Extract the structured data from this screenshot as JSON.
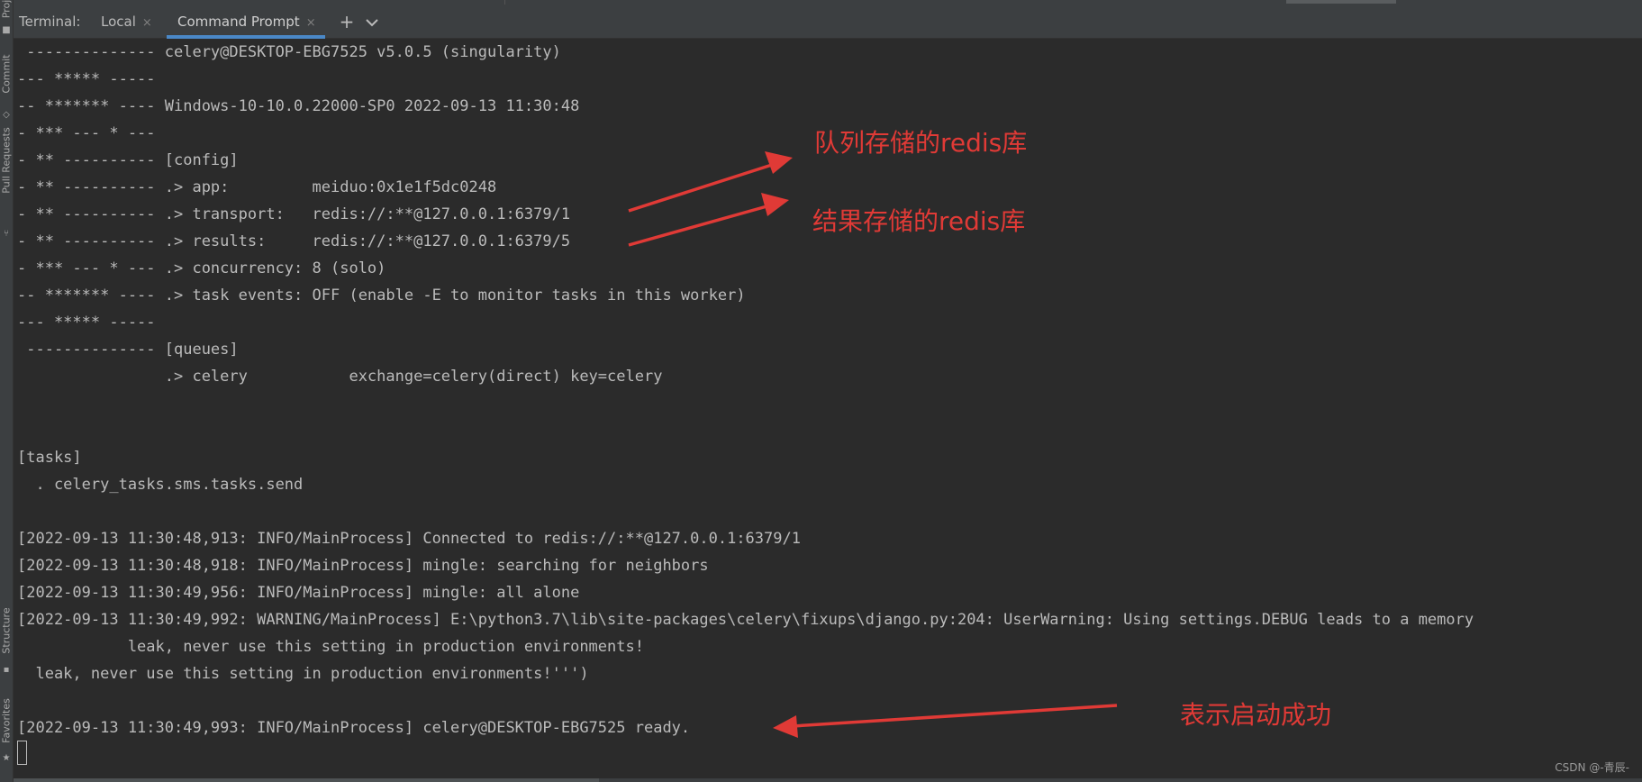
{
  "sidebar": {
    "project_label": "Proj",
    "commit_label": "Commit",
    "pull_requests_label": "Pull Requests",
    "structure_label": "Structure",
    "favorites_label": "Favorites"
  },
  "tabbar": {
    "title": "Terminal:",
    "tabs": [
      {
        "label": "Local"
      },
      {
        "label": "Command Prompt"
      }
    ],
    "close_glyph": "×",
    "add_glyph": "+",
    "chevron_icon": "chevron-down-icon"
  },
  "terminal": {
    "lines": [
      " -------------- celery@DESKTOP-EBG7525 v5.0.5 (singularity)",
      "--- ***** -----",
      "-- ******* ---- Windows-10-10.0.22000-SP0 2022-09-13 11:30:48",
      "- *** --- * ---",
      "- ** ---------- [config]",
      "- ** ---------- .> app:         meiduo:0x1e1f5dc0248",
      "- ** ---------- .> transport:   redis://:**@127.0.0.1:6379/1",
      "- ** ---------- .> results:     redis://:**@127.0.0.1:6379/5",
      "- *** --- * --- .> concurrency: 8 (solo)",
      "-- ******* ---- .> task events: OFF (enable -E to monitor tasks in this worker)",
      "--- ***** -----",
      " -------------- [queues]",
      "                .> celery           exchange=celery(direct) key=celery",
      "",
      "",
      "[tasks]",
      "  . celery_tasks.sms.tasks.send",
      "",
      "[2022-09-13 11:30:48,913: INFO/MainProcess] Connected to redis://:**@127.0.0.1:6379/1",
      "[2022-09-13 11:30:48,918: INFO/MainProcess] mingle: searching for neighbors",
      "[2022-09-13 11:30:49,956: INFO/MainProcess] mingle: all alone",
      "[2022-09-13 11:30:49,992: WARNING/MainProcess] E:\\python3.7\\lib\\site-packages\\celery\\fixups\\django.py:204: UserWarning: Using settings.DEBUG leads to a memory",
      "            leak, never use this setting in production environments!",
      "  leak, never use this setting in production environments!''')",
      "",
      "[2022-09-13 11:30:49,993: INFO/MainProcess] celery@DESKTOP-EBG7525 ready."
    ]
  },
  "annotations": {
    "queue_redis": "队列存储的redis库",
    "result_redis": "结果存储的redis库",
    "startup_success": "表示启动成功",
    "color": "#e03a36"
  },
  "watermark": "CSDN @-青辰-"
}
